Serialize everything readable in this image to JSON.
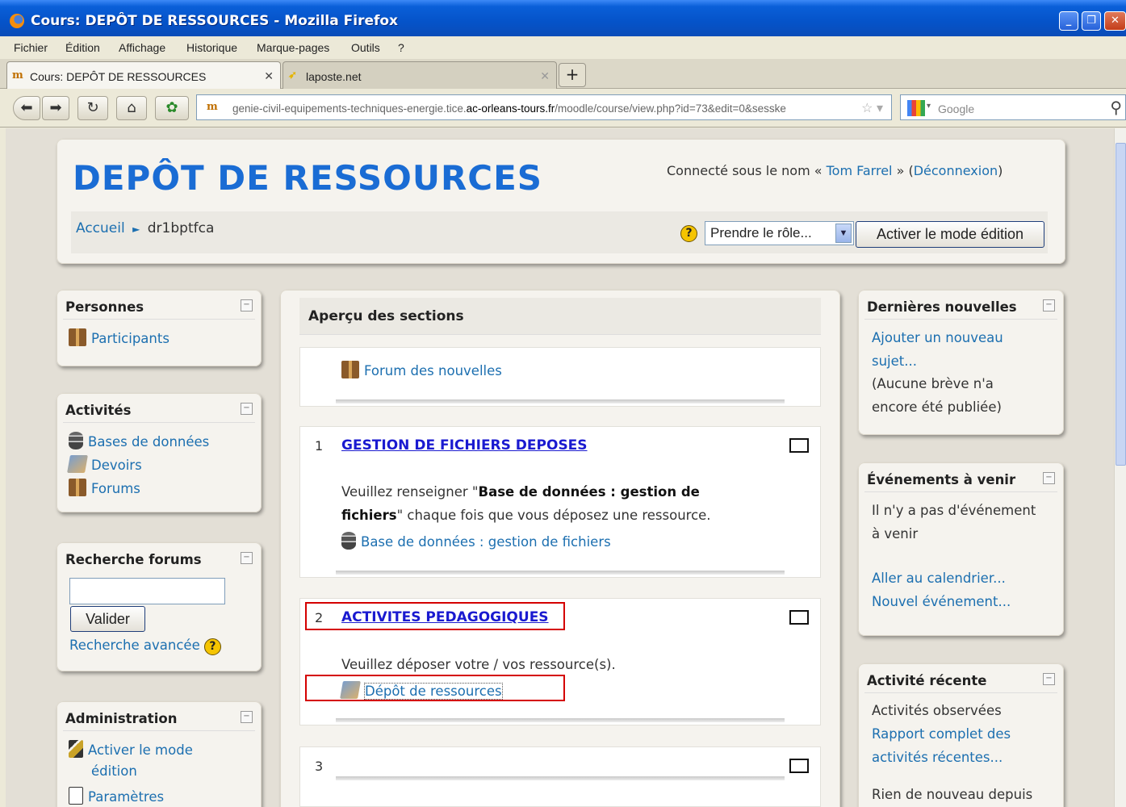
{
  "window": {
    "title": "Cours: DEPÔT DE RESSOURCES - Mozilla Firefox"
  },
  "menu": [
    "Fichier",
    "Édition",
    "Affichage",
    "Historique",
    "Marque-pages",
    "Outils",
    "?"
  ],
  "tabs": [
    {
      "label": "Cours: DEPÔT DE RESSOURCES",
      "active": true
    },
    {
      "label": "laposte.net",
      "active": false
    }
  ],
  "url": {
    "pre": "genie-civil-equipements-techniques-energie.tice.",
    "host": "ac-orleans-tours.fr",
    "post": "/moodle/course/view.php?id=73&edit=0&sesske"
  },
  "search_placeholder": "Google",
  "site": {
    "title": "DEPÔT DE RESSOURCES",
    "login_prefix": "Connecté sous le nom « ",
    "user": "Tom Farrel",
    "login_mid": " » (",
    "logout": "Déconnexion",
    "login_suffix": ")",
    "breadcrumb": {
      "home": "Accueil",
      "sep": "►",
      "current": "dr1bptfca"
    },
    "role_select": "Prendre le rôle...",
    "edit_button": "Activer le mode édition"
  },
  "left": {
    "persons": {
      "title": "Personnes",
      "items": [
        "Participants"
      ]
    },
    "activities": {
      "title": "Activités",
      "items": [
        "Bases de données",
        "Devoirs",
        "Forums"
      ]
    },
    "search": {
      "title": "Recherche forums",
      "button": "Valider",
      "advanced": "Recherche avancée"
    },
    "admin": {
      "title": "Administration",
      "items": [
        "Activer le mode",
        "édition",
        "Paramètres"
      ]
    }
  },
  "main": {
    "heading": "Aperçu des sections",
    "forum": "Forum des nouvelles",
    "s1": {
      "num": "1",
      "title": "GESTION DE FICHIERS DEPOSES",
      "text1": "Veuillez renseigner \"",
      "bold1": "Base de données : gestion de",
      "bold2": "fichiers",
      "text2": "\" chaque fois que vous déposez une ressource.",
      "link": "Base de données : gestion de fichiers"
    },
    "s2": {
      "num": "2",
      "title": "ACTIVITES PEDAGOGIQUES",
      "text": "Veuillez déposer votre / vos ressource(s).",
      "link": "Dépôt de ressources"
    },
    "s3": {
      "num": "3"
    }
  },
  "right": {
    "news": {
      "title": "Dernières nouvelles",
      "add1": "Ajouter un nouveau",
      "add2": "sujet...",
      "t1": "(Aucune brève n'a",
      "t2": "encore été publiée)"
    },
    "events": {
      "title": "Événements à venir",
      "t1": "Il n'y a pas d'événement",
      "t2": "à venir",
      "cal": "Aller au calendrier...",
      "new": "Nouvel événement..."
    },
    "recent": {
      "title": "Activité récente",
      "t1": "Activités observées",
      "l1": "Rapport complet des",
      "l2": "activités récentes...",
      "t2": "Rien de nouveau depuis"
    }
  },
  "colors": {
    "accent": "#1a6cd4",
    "link": "#1c6fb0",
    "section_title": "#1a1ad0",
    "highlight_box": "#d40000"
  }
}
